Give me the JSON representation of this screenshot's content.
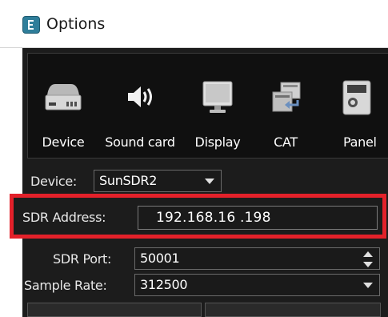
{
  "window": {
    "title": "Options",
    "icon": "app-icon"
  },
  "toolbar": {
    "items": [
      {
        "label": "Device",
        "icon": "device-drive-icon"
      },
      {
        "label": "Sound card",
        "icon": "speaker-icon"
      },
      {
        "label": "Display",
        "icon": "monitor-icon"
      },
      {
        "label": "CAT",
        "icon": "cat-transfer-icon"
      },
      {
        "label": "Panel",
        "icon": "panel-icon"
      }
    ]
  },
  "form": {
    "device": {
      "label": "Device:",
      "value": "SunSDR2"
    },
    "sdr_address": {
      "label": "SDR Address:",
      "value": "192.168.16 .198"
    },
    "sdr_port": {
      "label": "SDR Port:",
      "value": "50001"
    },
    "sample_rate": {
      "label": "Sample Rate:",
      "value": "312500"
    }
  },
  "colors": {
    "highlight": "#e3212a",
    "background": "#1c1c1c",
    "toolbar_bg": "#101010"
  }
}
